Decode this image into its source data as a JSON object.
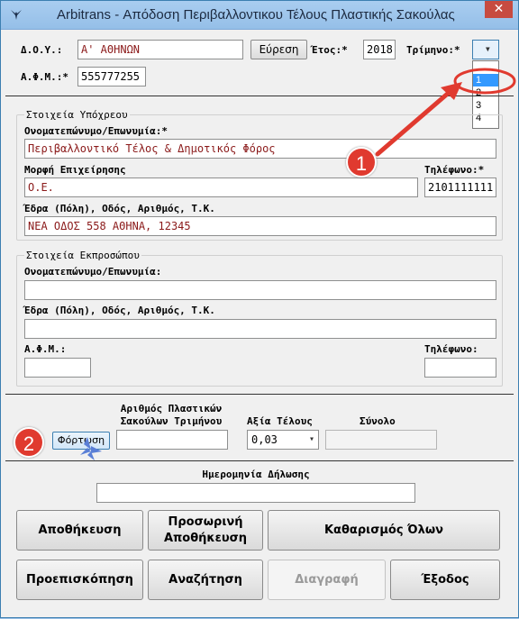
{
  "window": {
    "title": "Arbitrans - Απόδοση Περιβαλλοντικου Τέλους Πλαστικής Σακούλας",
    "close_glyph": "✕",
    "app_icon": "bird-icon"
  },
  "header": {
    "doy_label": "Δ.Ο.Υ.:",
    "doy_value": "Α' ΑΘΗΝΩΝ",
    "search_button": "Εύρεση",
    "year_label": "Έτος:*",
    "year_value": "2018",
    "quarter_label": "Τρίμηνο:*",
    "afm_label": "Α.Φ.Μ.:*",
    "afm_value": "555777255",
    "quarter_options": [
      "",
      "1",
      "2",
      "3",
      "4"
    ],
    "quarter_selected": "1"
  },
  "obligor": {
    "group_title": "Στοιχεία Υπόχρεου",
    "name_label": "Ονοματεπώνυμο/Επωνυμία:*",
    "name_value": "Περιβαλλοντικό Τέλος & Δημοτικός Φόρος",
    "form_label": "Μορφή Επιχείρησης",
    "form_value": "Ο.Ε.",
    "phone_label": "Τηλέφωνο:*",
    "phone_value": "2101111111",
    "address_label": "Έδρα (Πόλη), Οδός, Αριθμός, Τ.Κ.",
    "address_value": "ΝΕΑ ΟΔΟΣ 558 ΑΘΗΝΑ, 12345"
  },
  "representative": {
    "group_title": "Στοιχεία Εκπροσώπου",
    "name_label": "Ονοματεπώνυμο/Επωνυμία:",
    "name_value": "",
    "address_label": "Έδρα (Πόλη), Οδός, Αριθμός, Τ.Κ.",
    "address_value": "",
    "afm_label": "Α.Φ.Μ.:",
    "afm_value": "",
    "phone_label": "Τηλέφωνο:",
    "phone_value": ""
  },
  "bags": {
    "load_button": "Φόρτωση",
    "count_label_line1": "Αριθμός Πλαστικών",
    "count_label_line2": "Σακούλων Τριμήνου",
    "count_value": "",
    "fee_label": "Αξία Τέλους",
    "fee_value": "0,03",
    "total_label": "Σύνολο",
    "total_value": ""
  },
  "declaration": {
    "date_label": "Ημερομηνία Δήλωσης",
    "date_value": ""
  },
  "actions": {
    "save": "Αποθήκευση",
    "temp_save_line1": "Προσωρινή",
    "temp_save_line2": "Αποθήκευση",
    "clear_all": "Καθαρισμός Όλων",
    "preview": "Προεπισκόπηση",
    "search": "Αναζήτηση",
    "delete": "Διαγραφή",
    "exit": "Έξοδος"
  },
  "annotations": {
    "badge1": "1",
    "badge2": "2",
    "accent_color": "#e03a2f"
  }
}
